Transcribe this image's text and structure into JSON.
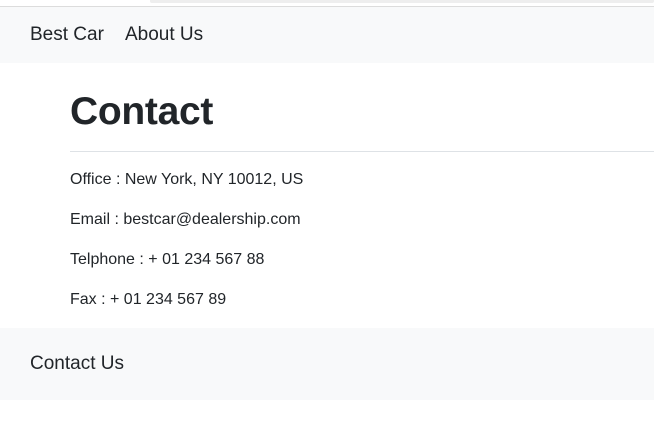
{
  "navbar": {
    "brand": "Best Car",
    "links": [
      "About Us"
    ]
  },
  "page": {
    "title": "Contact"
  },
  "contact": {
    "office": "Office : New York, NY 10012, US",
    "email": "Email : bestcar@dealership.com",
    "telephone": "Telphone : + 01 234 567 88",
    "fax": "Fax : + 01 234 567 89"
  },
  "footer": {
    "link": "Contact Us"
  },
  "colors": {
    "text": "#212529",
    "bar_background": "#f8f9fa",
    "divider": "#dee2e6"
  }
}
